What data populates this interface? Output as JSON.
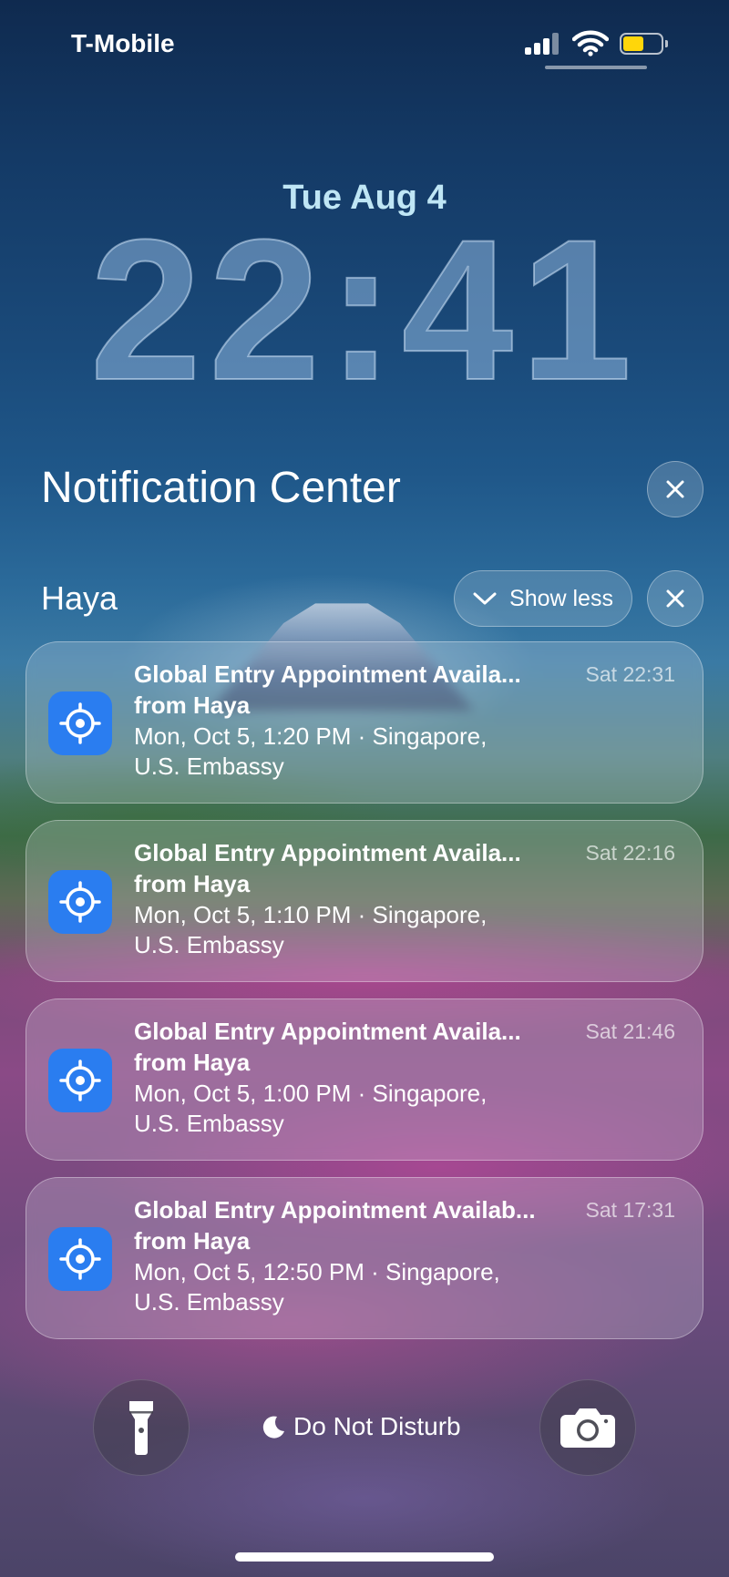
{
  "status_bar": {
    "carrier": "T-Mobile",
    "icons": [
      "cellular-signal-icon",
      "wifi-icon",
      "battery-icon"
    ],
    "battery_color": "#ffd60a"
  },
  "lock_screen": {
    "date": "Tue Aug 4",
    "time": "22:41"
  },
  "notification_center": {
    "title": "Notification Center",
    "group": {
      "app_name": "Haya",
      "show_less_label": "Show less",
      "notifications": [
        {
          "title": "Global Entry Appointment Availa...",
          "from": "from Haya",
          "line1": "Mon, Oct 5, 1:20 PM · Singapore,",
          "line2": "U.S. Embassy",
          "time": "Sat 22:31"
        },
        {
          "title": "Global Entry Appointment Availa...",
          "from": "from Haya",
          "line1": "Mon, Oct 5, 1:10 PM · Singapore,",
          "line2": "U.S. Embassy",
          "time": "Sat 22:16"
        },
        {
          "title": "Global Entry Appointment Availa...",
          "from": "from Haya",
          "line1": "Mon, Oct 5, 1:00 PM · Singapore,",
          "line2": "U.S. Embassy",
          "time": "Sat 21:46"
        },
        {
          "title": "Global Entry Appointment Availab...",
          "from": "from Haya",
          "line1": "Mon, Oct 5, 12:50 PM · Singapore,",
          "line2": "U.S. Embassy",
          "time": "Sat 17:31"
        }
      ]
    }
  },
  "bottom_bar": {
    "focus_label": "Do Not Disturb",
    "left_button": "flashlight-icon",
    "right_button": "camera-icon"
  },
  "colors": {
    "app_icon": "#2a7df0",
    "date_text": "#bfe6f5"
  }
}
